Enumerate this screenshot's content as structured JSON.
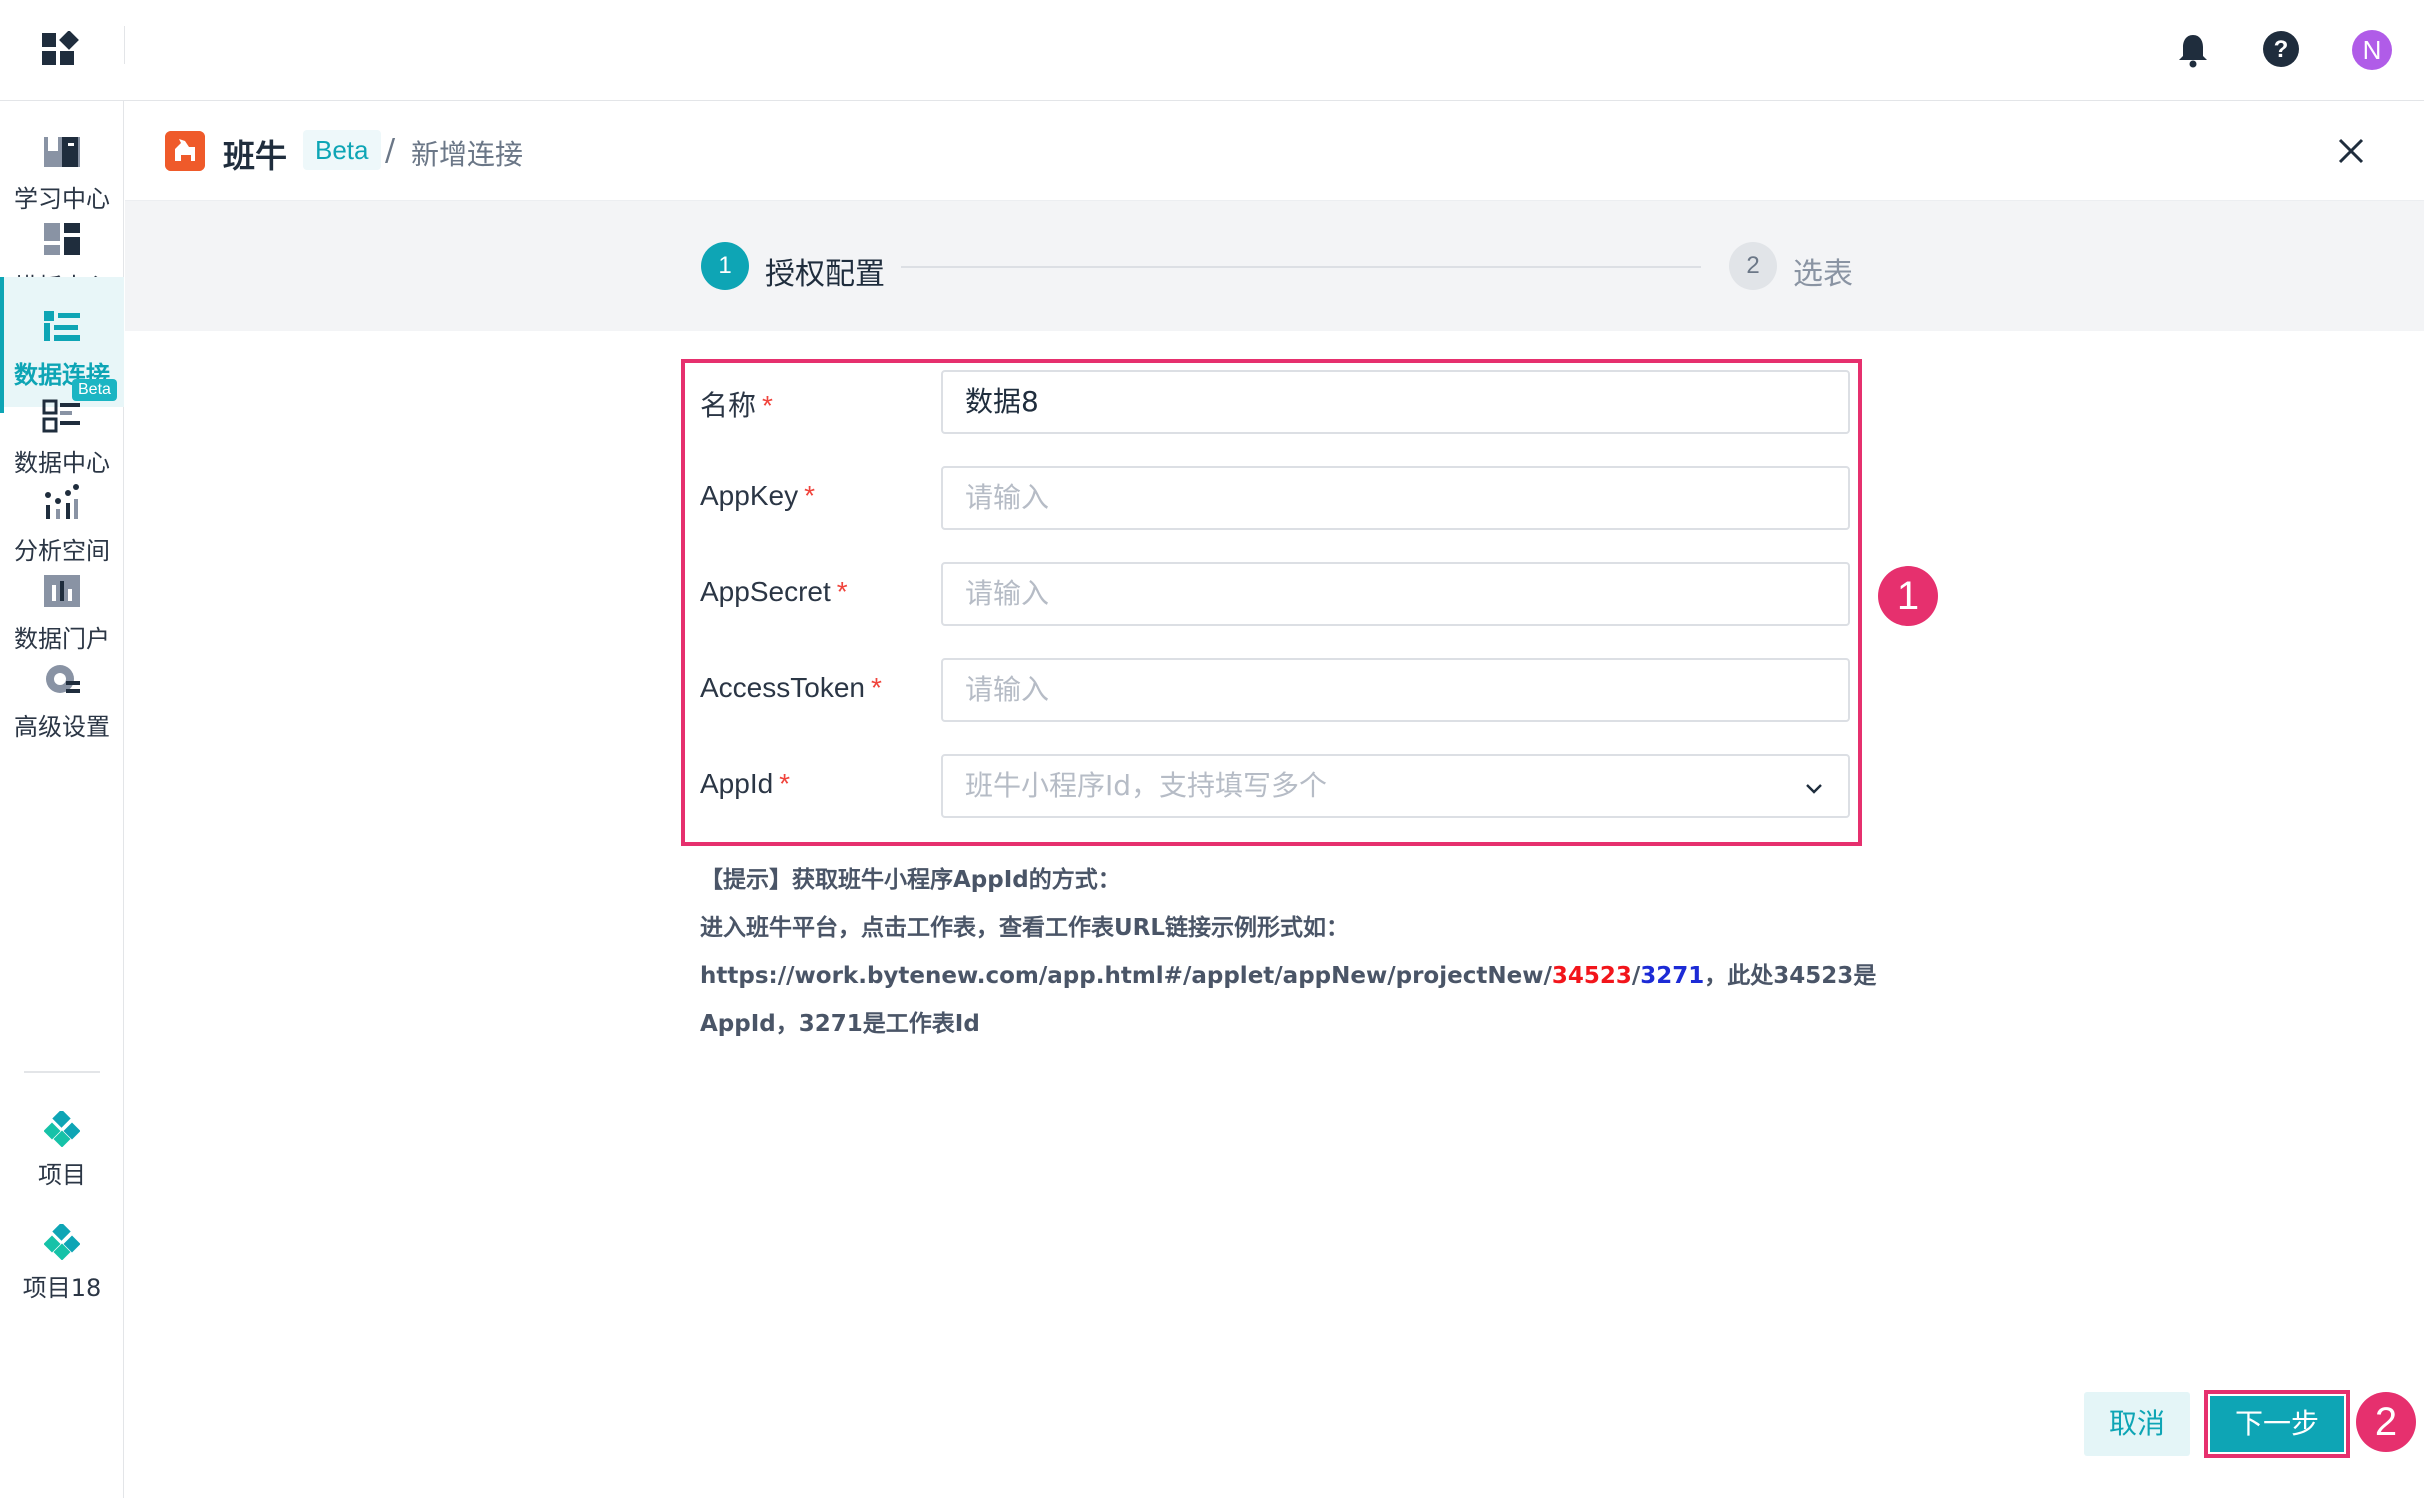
{
  "topbar": {
    "avatar_initial": "N",
    "icons": [
      "apps-grid-icon",
      "bell-icon",
      "help-icon"
    ]
  },
  "sidebar": {
    "items": [
      {
        "label": "学习中心",
        "icon": "book-icon"
      },
      {
        "label": "模板中心",
        "icon": "template-icon"
      },
      {
        "label": "数据连接",
        "icon": "data-connection-icon",
        "active": true
      },
      {
        "label": "数据中心",
        "icon": "data-center-icon",
        "badge": "Beta"
      },
      {
        "label": "分析空间",
        "icon": "analysis-icon"
      },
      {
        "label": "数据门户",
        "icon": "portal-icon"
      },
      {
        "label": "高级设置",
        "icon": "gear-icon"
      }
    ],
    "projects": [
      {
        "label": "项目",
        "icon": "project-icon"
      },
      {
        "label": "项目18",
        "icon": "project-icon"
      }
    ]
  },
  "header": {
    "brand": "班牛",
    "beta": "Beta",
    "separator": "/",
    "page": "新增连接"
  },
  "steps": [
    {
      "num": "1",
      "label": "授权配置",
      "active": true
    },
    {
      "num": "2",
      "label": "选表",
      "active": false
    }
  ],
  "form": {
    "fields": [
      {
        "label": "名称",
        "value": "数据8",
        "placeholder": ""
      },
      {
        "label": "AppKey",
        "value": "",
        "placeholder": "请输入"
      },
      {
        "label": "AppSecret",
        "value": "",
        "placeholder": "请输入"
      },
      {
        "label": "AccessToken",
        "value": "",
        "placeholder": "请输入"
      },
      {
        "label": "AppId",
        "value": "",
        "placeholder": "班牛小程序Id，支持填写多个"
      }
    ],
    "required_mark": "*"
  },
  "hint": {
    "line1": "【提示】获取班牛小程序AppId的方式：",
    "line2": "进入班牛平台，点击工作表，查看工作表URL链接示例形式如：",
    "url_prefix": "https://work.bytenew.com/app.html#/applet/appNew/projectNew/",
    "url_appid": "34523",
    "url_slash": "/",
    "url_sheet": "3271",
    "line3_suffix": "，此处34523是",
    "line4": "AppId，3271是工作表Id"
  },
  "annotations": [
    "1",
    "2"
  ],
  "footer": {
    "cancel": "取消",
    "next": "下一步"
  },
  "colors": {
    "accent": "#0ea5b5",
    "annotation": "#e6306e",
    "required": "#f0443c"
  }
}
